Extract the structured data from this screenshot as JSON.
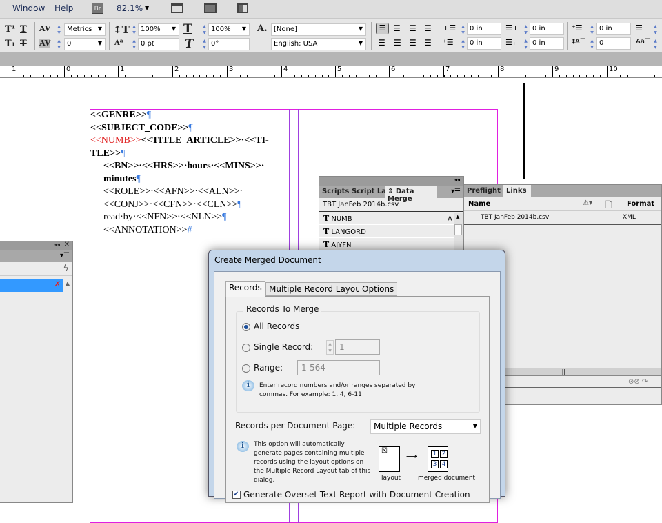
{
  "menubar": {
    "items": [
      "Window",
      "Help"
    ],
    "bridge": "Br",
    "zoom": "82.1%"
  },
  "control": {
    "kerning": "Metrics",
    "tracking": "0",
    "vscale": "100%",
    "hscale": "100%",
    "baseline": "0 pt",
    "skew": "0°",
    "char_style": "[None]",
    "language": "English: USA",
    "left_indent": "0 in",
    "first_indent": "0 in",
    "right_indent": "0 in",
    "last_indent": "0 in",
    "space_before": "0 in",
    "dropcap": "0"
  },
  "ruler": {
    "labels": [
      "1",
      "0",
      "1",
      "2",
      "3",
      "4",
      "5",
      "6",
      "7",
      "8",
      "9",
      "10"
    ]
  },
  "document": {
    "lines": [
      {
        "parts": [
          {
            "t": "<<GENRE>>",
            "b": true
          },
          {
            "t": "¶",
            "p": true
          }
        ],
        "indent": false
      },
      {
        "parts": [
          {
            "t": "<<SUBJECT_CODE>>",
            "b": true
          },
          {
            "t": "¶",
            "p": true
          }
        ],
        "indent": false
      },
      {
        "parts": [
          {
            "t": "<<NUMB>>",
            "r": true
          },
          {
            "t": "<<TITLE_ARTICLE>>·<<TI-",
            "b": true
          }
        ],
        "indent": false
      },
      {
        "parts": [
          {
            "t": "TLE>>",
            "b": true
          },
          {
            "t": "¶",
            "p": true
          }
        ],
        "indent": false
      },
      {
        "parts": [
          {
            "t": "<<BN>>·<<HRS>>·hours·<<MINS>>·",
            "b": true
          }
        ],
        "indent": true
      },
      {
        "parts": [
          {
            "t": "minutes",
            "b": true
          },
          {
            "t": "¶",
            "p": true
          }
        ],
        "indent": true
      },
      {
        "parts": [
          {
            "t": "<<ROLE>>·<<AFN>>·<<ALN>>·"
          }
        ],
        "indent": true
      },
      {
        "parts": [
          {
            "t": "<<CONJ>>·<<CFN>>·<<CLN>>"
          },
          {
            "t": "¶",
            "p": true
          }
        ],
        "indent": true
      },
      {
        "parts": [
          {
            "t": "read·by·<<NFN>>·<<NLN>>"
          },
          {
            "t": "¶",
            "p": true
          }
        ],
        "indent": true
      },
      {
        "parts": [
          {
            "t": "<<ANNOTATION>>"
          },
          {
            "t": "#",
            "p": true
          }
        ],
        "indent": true
      }
    ]
  },
  "datamerge": {
    "tabs": [
      "Scripts",
      "Script Lab",
      "Data Merge"
    ],
    "file": "TBT JanFeb 2014b.csv",
    "fields": [
      "NUMB",
      "LANGORD",
      "AJYFN"
    ],
    "field_type_flag": "A"
  },
  "links": {
    "tabs": [
      "Preflight",
      "Links"
    ],
    "columns": [
      "Name",
      "Format"
    ],
    "rows": [
      {
        "name": "TBT JanFeb 2014b.csv",
        "format": "XML"
      }
    ]
  },
  "dialog": {
    "title": "Create Merged Document",
    "tabs": [
      "Records",
      "Multiple Record Layout",
      "Options"
    ],
    "group": "Records To Merge",
    "radios": [
      {
        "label": "All Records",
        "checked": true
      },
      {
        "label": "Single Record:",
        "checked": false
      },
      {
        "label": "Range:",
        "checked": false
      }
    ],
    "single_value": "1",
    "range_value": "1-564",
    "info1": "Enter record numbers and/or ranges separated by commas. For example: 1, 4, 6-11",
    "per_page_label": "Records per Document Page:",
    "per_page_value": "Multiple Records",
    "info2": "This option will automatically generate pages containing multiple records using the layout options on the Multiple Record Layout tab of this dialog.",
    "layout_label": "layout",
    "merged_label": "merged document",
    "merged_cells": [
      "1",
      "2",
      "3",
      "4"
    ],
    "overset_label": "Generate Overset Text Report with Document Creation",
    "overset_checked": true
  },
  "colors": {
    "frame": "#e020e0",
    "selection": "#3399ff",
    "accent_red": "#e02020"
  }
}
